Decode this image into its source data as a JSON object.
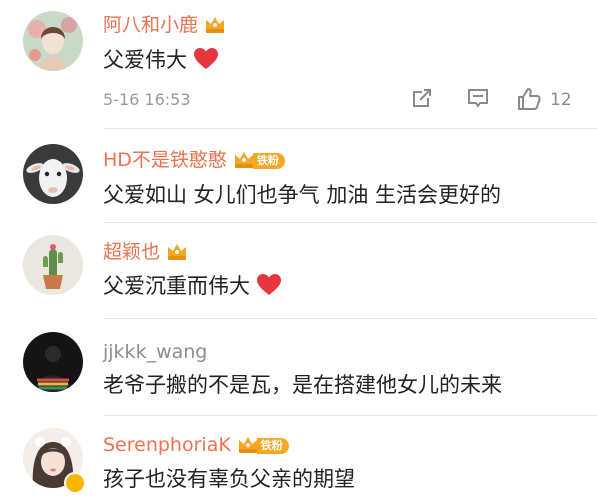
{
  "comments": [
    {
      "username": "阿八和小鹿",
      "text": "父爱伟大",
      "timestamp": "5-16 16:53",
      "likes": "12",
      "avatar_icon": "girl-avatar-illustration",
      "heart": true
    },
    {
      "username": "HD不是铁憨憨",
      "badge": "铁粉",
      "text": "父爱如山 女儿们也争气 加油 生活会更好的",
      "avatar_icon": "goat-avatar"
    },
    {
      "username": "超颖也",
      "text": "父爱沉重而伟大",
      "avatar_icon": "cactus-avatar",
      "heart": true
    },
    {
      "username": "jjkkk_wang",
      "text": "老爷子搬的不是瓦，是在搭建他女儿的未来",
      "avatar_icon": "dark-figure-avatar"
    },
    {
      "username": "SerenphoriaK",
      "badge": "铁粉",
      "text": "孩子也没有辜负父亲的期望",
      "avatar_icon": "girl-photo-avatar"
    }
  ],
  "colors": {
    "username_vip": "#eb7350",
    "username_normal": "#8d8d8d",
    "heart": "#e8363f",
    "crown": "#f5a623"
  }
}
